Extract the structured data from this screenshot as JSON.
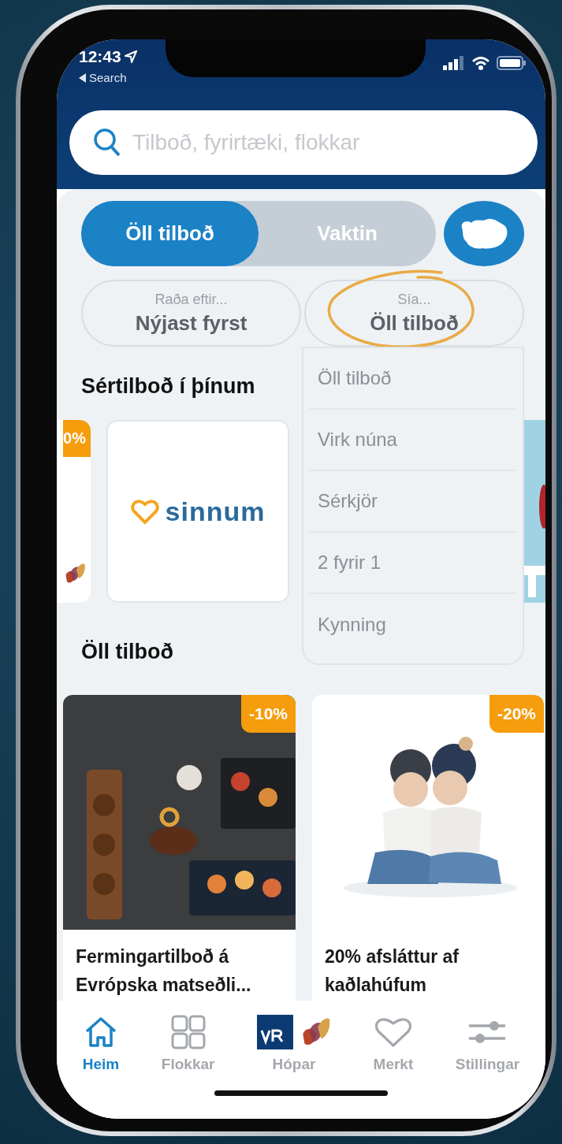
{
  "status_bar": {
    "time": "12:43",
    "back_link": "Search"
  },
  "search": {
    "placeholder": "Tilboð, fyrirtæki, flokkar"
  },
  "segments": [
    {
      "label": "Öll tilboð",
      "selected": true
    },
    {
      "label": "Vaktin",
      "selected": false
    }
  ],
  "filters": [
    {
      "caption": "Raða eftir...",
      "value": "Nýjast fyrst",
      "highlighted": false
    },
    {
      "caption": "Sía...",
      "value": "Öll tilboð",
      "highlighted": true,
      "menu": [
        "Öll tilboð",
        "Virk núna",
        "Sérkjör",
        "2 fyrir 1",
        "Kynning"
      ]
    }
  ],
  "featured": {
    "title": "Sértilboð í þínum",
    "cards": [
      {
        "kind": "partial",
        "badge": "0%"
      },
      {
        "kind": "logo",
        "logo_text": "sinnum"
      },
      {
        "kind": "picture"
      }
    ]
  },
  "offers": {
    "title": "Öll tilboð",
    "cards": [
      {
        "badge": "-10%",
        "title": "Fermingartilboð á Evrópska matseðli..."
      },
      {
        "badge": "-20%",
        "title": "20% afsláttur af kaðlahúfum"
      }
    ]
  },
  "tabs": [
    {
      "label": "Heim",
      "selected": true
    },
    {
      "label": "Flokkar",
      "selected": false
    },
    {
      "label": "Hópar",
      "selected": false
    },
    {
      "label": "Merkt",
      "selected": false
    },
    {
      "label": "Stillingar",
      "selected": false
    }
  ]
}
